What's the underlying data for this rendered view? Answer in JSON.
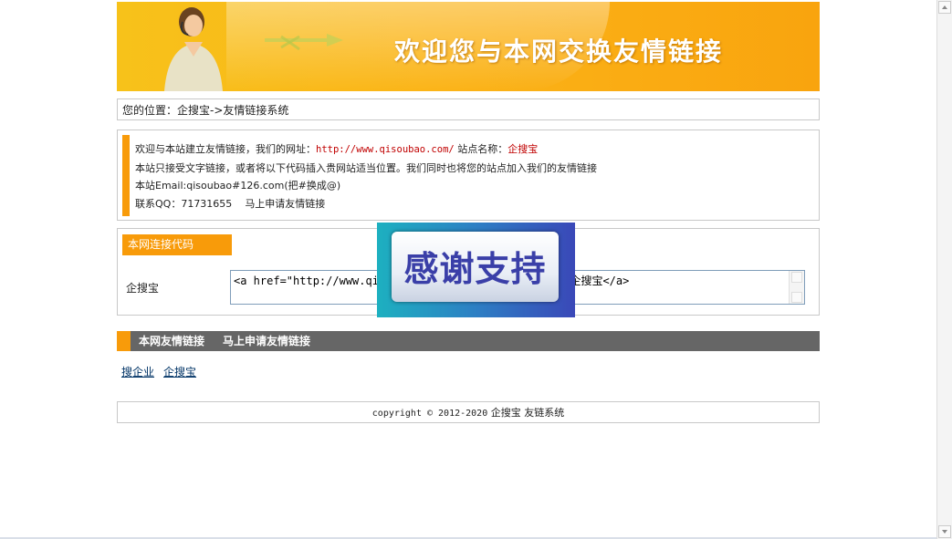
{
  "banner": {
    "title": "欢迎您与本网交换友情链接"
  },
  "location": {
    "label": "您的位置：",
    "path": "企搜宝->友情链接系统"
  },
  "intro": {
    "line1_prefix": "欢迎与本站建立友情链接，我们的网址：",
    "url": "http://www.qisoubao.com/",
    "line1_mid": " 站点名称：",
    "site_name": "企搜宝",
    "line2": "本站只接受文字链接，或者将以下代码插入贵网站适当位置。我们同时也将您的站点加入我们的友情链接",
    "line3": "本站Email:qisoubao#126.com(把#换成@)",
    "line4_qq": "联系QQ：71731655",
    "line4_apply": "马上申请友情链接"
  },
  "code": {
    "tab_label": "本网连接代码",
    "row_label": "企搜宝",
    "textarea_value": "<a href=\"http://www.qisoubao.com/\" target=\"_blank\">企搜宝</a>"
  },
  "friend_bar": {
    "title": "本网友情链接",
    "apply": "马上申请友情链接"
  },
  "friend_links": [
    "搜企业",
    "企搜宝"
  ],
  "footer": {
    "copyright": "copyright © 2012-2020",
    "site": "企搜宝 友链系统"
  },
  "popup": {
    "text": "感谢支持"
  },
  "colors": {
    "accent": "#f89b0a",
    "bar": "#666666",
    "link_red": "#c00000"
  }
}
